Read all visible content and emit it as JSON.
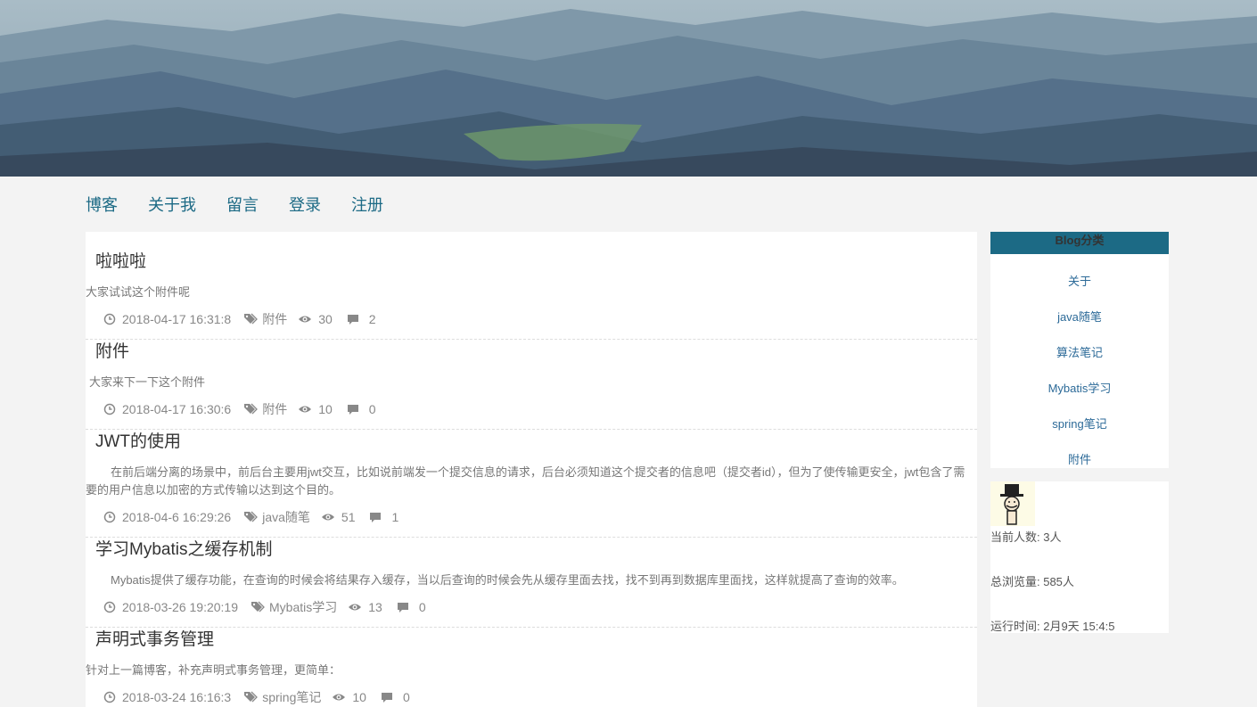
{
  "nav": {
    "items": [
      "博客",
      "关于我",
      "留言",
      "登录",
      "注册"
    ]
  },
  "posts": [
    {
      "title": "啦啦啦",
      "summary": "大家试试这个附件呢",
      "date": "2018-04-17 16:31:8",
      "tag": "附件",
      "views": "30",
      "comments": "2"
    },
    {
      "title": "附件",
      "summary": "大家来下一下这个附件",
      "date": "2018-04-17 16:30:6",
      "tag": "附件",
      "views": "10",
      "comments": "0"
    },
    {
      "title": "JWT的使用",
      "summary": "在前后端分离的场景中，前后台主要用jwt交互，比如说前端发一个提交信息的请求，后台必须知道这个提交者的信息吧（提交者id），但为了使传输更安全，jwt包含了需要的用户信息以加密的方式传输以达到这个目的。",
      "date": "2018-04-6 16:29:26",
      "tag": "java随笔",
      "views": "51",
      "comments": "1"
    },
    {
      "title": "学习Mybatis之缓存机制",
      "summary": "Mybatis提供了缓存功能，在查询的时候会将结果存入缓存，当以后查询的时候会先从缓存里面去找，找不到再到数据库里面找，这样就提高了查询的效率。",
      "date": "2018-03-26 19:20:19",
      "tag": "Mybatis学习",
      "views": "13",
      "comments": "0"
    },
    {
      "title": "声明式事务管理",
      "summary": "针对上一篇博客，补充声明式事务管理，更简单：",
      "date": "2018-03-24 16:16:3",
      "tag": "spring笔记",
      "views": "10",
      "comments": "0"
    }
  ],
  "sidebar": {
    "categories_title": "Blog分类",
    "categories": [
      "关于",
      "java随笔",
      "算法笔记",
      "Mybatis学习",
      "spring笔记",
      "附件"
    ],
    "online_label": "当前人数: 3人",
    "total_views_label": "总浏览量: 585人",
    "runtime_label": "运行时间: 2月9天 15:4:5"
  },
  "colors": {
    "accent": "#1c6a85",
    "link": "#2c6a98",
    "meta": "#888888"
  }
}
